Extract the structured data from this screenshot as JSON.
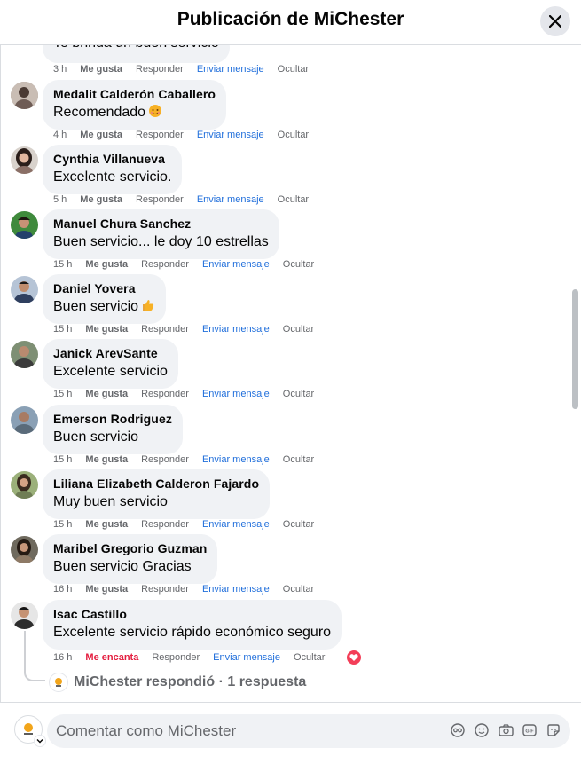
{
  "header": {
    "title": "Publicación de MiChester"
  },
  "partial_comment": {
    "text": "Te brinda un buen servicio",
    "time": "3 h",
    "like": "Me gusta",
    "reply": "Responder",
    "message": "Enviar mensaje",
    "hide": "Ocultar"
  },
  "comments": [
    {
      "author": "Medalit Calderón Caballero",
      "text": "Recomendado",
      "emoji": "smiling-face-emoji",
      "time": "4 h",
      "like": "Me gusta",
      "reply": "Responder",
      "message": "Enviar mensaje",
      "hide": "Ocultar"
    },
    {
      "author": "Cynthia Villanueva",
      "text": "Excelente servicio.",
      "time": "5 h",
      "like": "Me gusta",
      "reply": "Responder",
      "message": "Enviar mensaje",
      "hide": "Ocultar"
    },
    {
      "author": "Manuel Chura Sanchez",
      "text": "Buen servicio... le doy 10 estrellas",
      "time": "15 h",
      "like": "Me gusta",
      "reply": "Responder",
      "message": "Enviar mensaje",
      "hide": "Ocultar"
    },
    {
      "author": "Daniel Yovera",
      "text": "Buen servicio",
      "emoji": "thumbs-up-emoji",
      "time": "15 h",
      "like": "Me gusta",
      "reply": "Responder",
      "message": "Enviar mensaje",
      "hide": "Ocultar"
    },
    {
      "author": "Janick ArevSante",
      "text": "Excelente servicio",
      "time": "15 h",
      "like": "Me gusta",
      "reply": "Responder",
      "message": "Enviar mensaje",
      "hide": "Ocultar"
    },
    {
      "author": "Emerson Rodriguez",
      "text": "Buen servicio",
      "time": "15 h",
      "like": "Me gusta",
      "reply": "Responder",
      "message": "Enviar mensaje",
      "hide": "Ocultar"
    },
    {
      "author": "Liliana Elizabeth Calderon Fajardo",
      "text": "Muy buen servicio",
      "time": "15 h",
      "like": "Me gusta",
      "reply": "Responder",
      "message": "Enviar mensaje",
      "hide": "Ocultar"
    },
    {
      "author": "Maribel Gregorio Guzman",
      "text": "Buen servicio Gracias",
      "time": "16 h",
      "like": "Me gusta",
      "reply": "Responder",
      "message": "Enviar mensaje",
      "hide": "Ocultar"
    },
    {
      "author": "Isac Castillo",
      "text": "Excelente servicio rápido económico seguro",
      "time": "16 h",
      "like": "Me encanta",
      "reply": "Responder",
      "message": "Enviar mensaje",
      "hide": "Ocultar",
      "reaction": "heart-reaction-icon"
    }
  ],
  "replies_summary": "MiChester respondió · 1 respuesta",
  "composer": {
    "placeholder": "Comentar como MiChester"
  },
  "colors": {
    "link": "#216fdb",
    "love": "#e41e3f",
    "bubble": "#f0f2f5",
    "muted": "#65676b"
  }
}
